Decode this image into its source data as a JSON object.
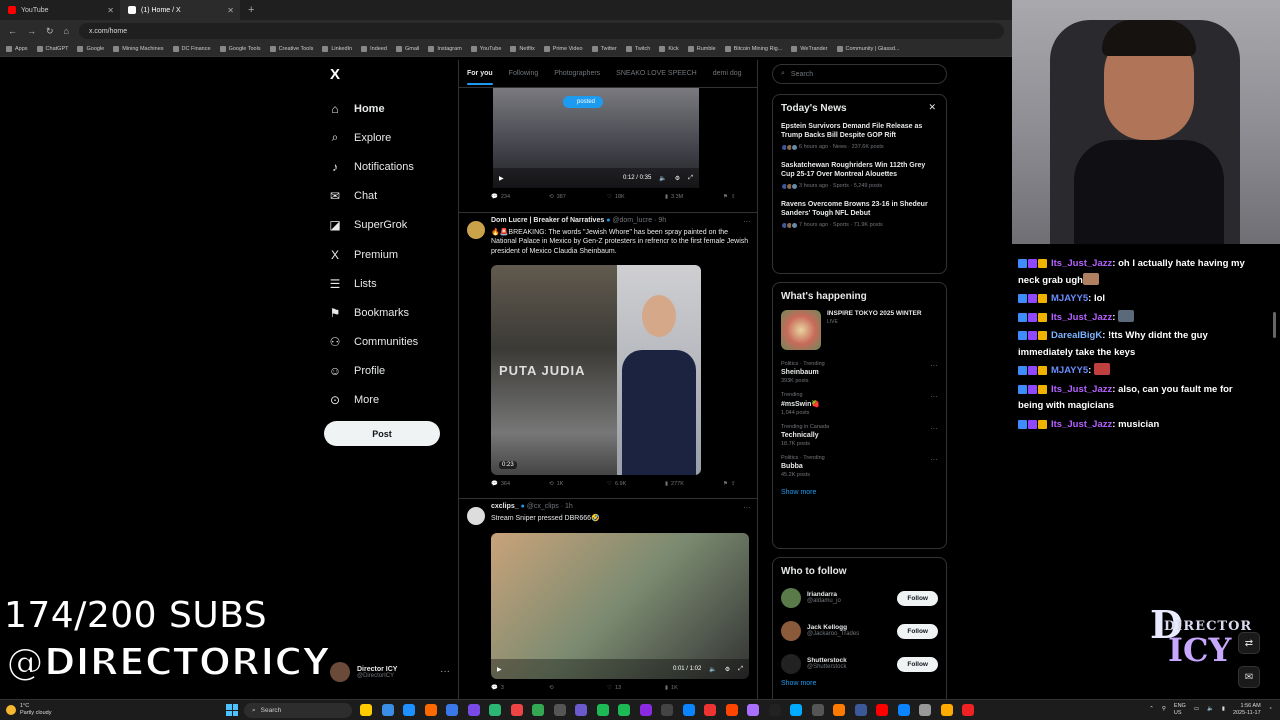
{
  "browser": {
    "tabs": [
      {
        "label": "YouTube",
        "color": "#ff0000",
        "active": false
      },
      {
        "label": "(1) Home / X",
        "color": "#ffffff",
        "active": true
      }
    ],
    "url": "x.com/home",
    "bookmarks": [
      "Apps",
      "ChatGPT",
      "Google",
      "Mining Machines",
      "DC Finance",
      "Google Tools",
      "Creative Tools",
      "LinkedIn",
      "Indeed",
      "Gmail",
      "Instagram",
      "YouTube",
      "Netflix",
      "Prime Video",
      "Twitter",
      "Twitch",
      "Kick",
      "Rumble",
      "Bitcoin Mining Rig...",
      "WeTrander",
      "Community | Glassd..."
    ]
  },
  "xnav": {
    "logo": "X",
    "items": [
      {
        "label": "Home",
        "icon": "home-icon",
        "glyph": "⌂"
      },
      {
        "label": "Explore",
        "icon": "search-icon",
        "glyph": "⌕"
      },
      {
        "label": "Notifications",
        "icon": "bell-icon",
        "glyph": "♪"
      },
      {
        "label": "Chat",
        "icon": "mail-icon",
        "glyph": "✉"
      },
      {
        "label": "SuperGrok",
        "icon": "grok-icon",
        "glyph": "◪"
      },
      {
        "label": "Premium",
        "icon": "x-premium-icon",
        "glyph": "X"
      },
      {
        "label": "Lists",
        "icon": "list-icon",
        "glyph": "☰"
      },
      {
        "label": "Bookmarks",
        "icon": "bookmark-icon",
        "glyph": "⚑"
      },
      {
        "label": "Communities",
        "icon": "people-icon",
        "glyph": "⚇"
      },
      {
        "label": "Profile",
        "icon": "person-icon",
        "glyph": "☺"
      },
      {
        "label": "More",
        "icon": "more-circle-icon",
        "glyph": "⊙"
      }
    ],
    "post_label": "Post",
    "me_name": "Director ICY",
    "me_handle": "@DirectorICY"
  },
  "overlay": {
    "subs": "174/200 SUBS",
    "handle": "@DIRECTORICY"
  },
  "timeline": {
    "tabs": [
      "For you",
      "Following",
      "Photographers",
      "SNEAKO LOVE SPEECH",
      "demi dog"
    ],
    "video1": {
      "pill": "posted",
      "time": "0:12 / 0:35",
      "stats": [
        "234",
        "387",
        "18K",
        "3.3M"
      ]
    },
    "post2": {
      "author": "Dom Lucre | Breaker of Narratives",
      "handle": "@dom_lucre · 9h",
      "text": "🔥🚨BREAKING: The words \"Jewish Whore\" has been spray painted on the National Palace in Mexico by Gen-Z protesters in refrencr to the first female Jewish president of Mexico Claudia Sheinbaum.",
      "graffiti": "PUTA JUDIA",
      "duration": "0:23",
      "stats": [
        "364",
        "1K",
        "6.9K",
        "277K"
      ]
    },
    "post3": {
      "author": "cxclips_",
      "handle": "@cx_clips · 1h",
      "text": "Stream Sniper pressed DBR666🤣",
      "time": "0:01 / 1:02",
      "stats": [
        "3",
        "",
        "13",
        "1K"
      ]
    }
  },
  "right": {
    "search_placeholder": "Search",
    "news_title": "Today's News",
    "news": [
      {
        "title": "Epstein Survivors Demand File Release as Trump Backs Bill Despite GOP Rift",
        "meta": "6 hours ago · News · 237.6K posts"
      },
      {
        "title": "Saskatchewan Roughriders Win 112th Grey Cup 25-17 Over Montreal Alouettes",
        "meta": "3 hours ago · Sports · 5,249 posts"
      },
      {
        "title": "Ravens Overcome Browns 23-16 in Shedeur Sanders' Tough NFL Debut",
        "meta": "7 hours ago · Sports · 71.9K posts"
      }
    ],
    "happening_title": "What's happening",
    "event": {
      "title": "INSPIRE TOKYO 2025 WINTER",
      "status": "LIVE"
    },
    "trends": [
      {
        "cat": "Politics · Trending",
        "name": "Sheinbaum",
        "count": "393K posts"
      },
      {
        "cat": "Trending",
        "name": "#msSwin🍓",
        "count": "1,044 posts"
      },
      {
        "cat": "Trending in Canada",
        "name": "Technically",
        "count": "18.7K posts"
      },
      {
        "cat": "Politics · Trending",
        "name": "Bubba",
        "count": "45.2K posts"
      }
    ],
    "show_more": "Show more",
    "follow_title": "Who to follow",
    "follow": [
      {
        "name": "Iriandarra",
        "handle": "@aldamu_jo",
        "color": "#5a7a4a"
      },
      {
        "name": "Jack Kellogg",
        "handle": "@Jackaroo_Trades",
        "color": "#8a5a3a"
      },
      {
        "name": "Shutterstock",
        "handle": "@Shutterstock",
        "color": "#222222"
      }
    ],
    "follow_label": "Follow",
    "show_more2": "Show more"
  },
  "chat": [
    {
      "user": "Its_Just_Jazz",
      "msg": ": oh I actually hate having my neck grab ugh",
      "ucls": "u1",
      "emote": "#b08060"
    },
    {
      "user": "MJAYY5",
      "msg": ": lol",
      "ucls": "u2",
      "emote": ""
    },
    {
      "user": "Its_Just_Jazz",
      "msg": ": ",
      "ucls": "u1",
      "emote": "#5a6a7a"
    },
    {
      "user": "DarealBigK",
      "msg": ": !tts Why didnt the guy immediately take the keys",
      "ucls": "u3",
      "emote": ""
    },
    {
      "user": "MJAYY5",
      "msg": ": ",
      "ucls": "u2",
      "emote": "#c04040"
    },
    {
      "user": "Its_Just_Jazz",
      "msg": ": also, can you fault me for being with magicians",
      "ucls": "u1",
      "emote": ""
    },
    {
      "user": "Its_Just_Jazz",
      "msg": ": musician",
      "ucls": "u1",
      "emote": ""
    }
  ],
  "brand": {
    "line1": "DIRECTOR",
    "line2": "ICY"
  },
  "taskbar": {
    "temp": "1°C",
    "weather": "Partly cloudy",
    "search": "Search",
    "lang1": "ENG",
    "lang2": "US",
    "time": "1:56 AM",
    "date": "2025-11-17",
    "app_colors": [
      "#ffcc00",
      "#3a8ee6",
      "#1e90ff",
      "#ff6a00",
      "#3b78e7",
      "#7a4ae6",
      "#2bb673",
      "#e44",
      "#34a853",
      "#555",
      "#6a5acd",
      "#1db954",
      "#1db954",
      "#8a2be2",
      "#444",
      "#0a84ff",
      "#e33",
      "#ff4500",
      "#a970ff",
      "#222",
      "#00aaff",
      "#555",
      "#ff7a00",
      "#3b5998",
      "#ff0000",
      "#0b84ff",
      "#999",
      "#ffaa00",
      "#e22"
    ]
  }
}
